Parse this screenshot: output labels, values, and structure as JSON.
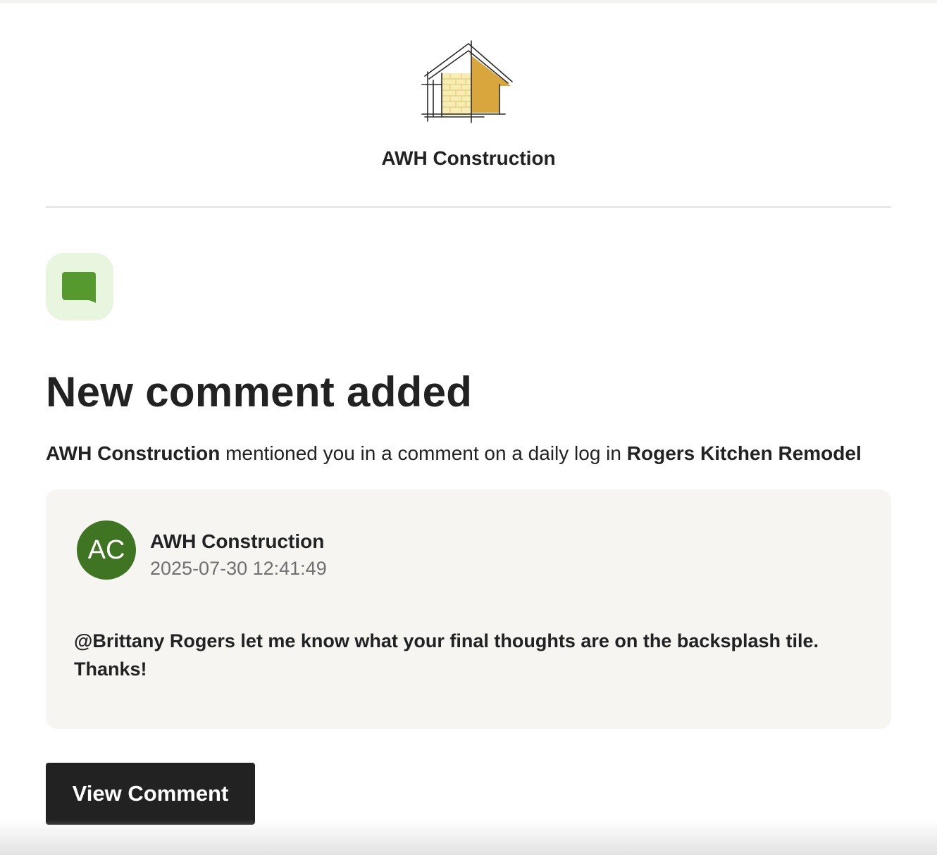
{
  "brand": {
    "company_name": "AWH Construction",
    "logo_icon": "house-blueprint-logo-icon"
  },
  "notification": {
    "icon": "comment-bubble-icon",
    "title": "New comment added",
    "mention": {
      "actor": "AWH Construction",
      "text": " mentioned you in a comment on a daily log in ",
      "project": "Rogers Kitchen Remodel"
    }
  },
  "comment": {
    "avatar_initials": "AC",
    "author": "AWH Construction",
    "timestamp": "2025-07-30 12:41:49",
    "body": "@Brittany Rogers let me know what your final thoughts are on the backsplash tile. Thanks!"
  },
  "actions": {
    "view_label": "View Comment"
  },
  "colors": {
    "accent_green": "#3f7423",
    "icon_bg": "#e8f6e0",
    "icon_green": "#56992f",
    "logo_gold": "#d9a53d",
    "button_bg": "#222222",
    "card_bg": "#f6f5f1"
  }
}
